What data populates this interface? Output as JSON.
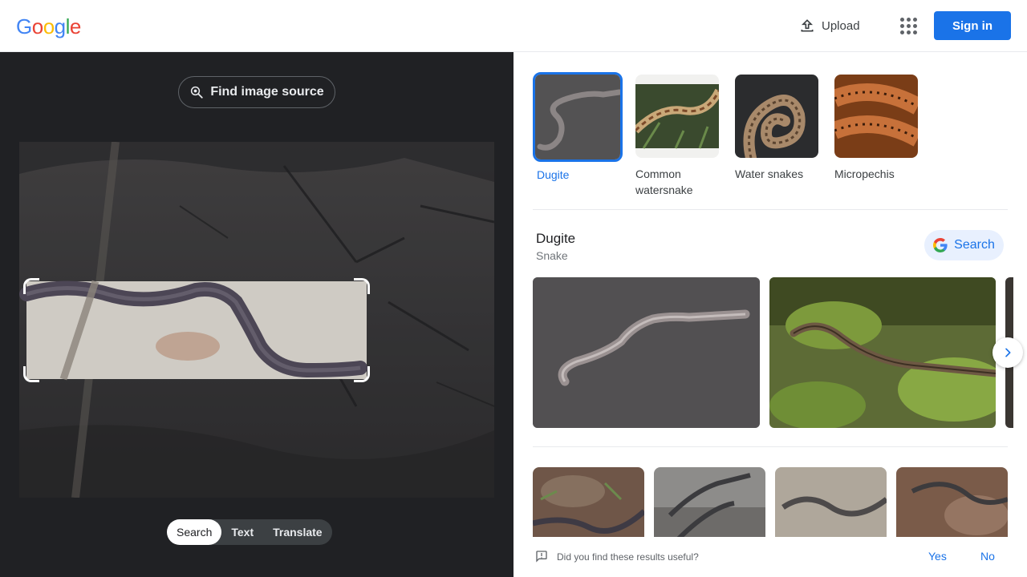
{
  "header": {
    "logo_letters": [
      "G",
      "o",
      "o",
      "g",
      "l",
      "e"
    ],
    "upload_label": "Upload",
    "signin_label": "Sign in"
  },
  "left_panel": {
    "find_source_label": "Find image source",
    "modes": [
      {
        "label": "Search",
        "active": true
      },
      {
        "label": "Text",
        "active": false
      },
      {
        "label": "Translate",
        "active": false
      }
    ]
  },
  "right_panel": {
    "chips": [
      {
        "label": "Dugite",
        "selected": true
      },
      {
        "label": "Common watersnake",
        "selected": false
      },
      {
        "label": "Water snakes",
        "selected": false
      },
      {
        "label": "Micropechis",
        "selected": false
      }
    ],
    "entity": {
      "title": "Dugite",
      "subtitle": "Snake",
      "search_label": "Search"
    },
    "feedback": {
      "question": "Did you find these results useful?",
      "yes": "Yes",
      "no": "No"
    }
  },
  "colors": {
    "accent": "#1a73e8",
    "dark_panel": "#202124",
    "google_blue": "#4285f4",
    "google_red": "#ea4335",
    "google_yellow": "#fbbc05",
    "google_green": "#34a853"
  }
}
